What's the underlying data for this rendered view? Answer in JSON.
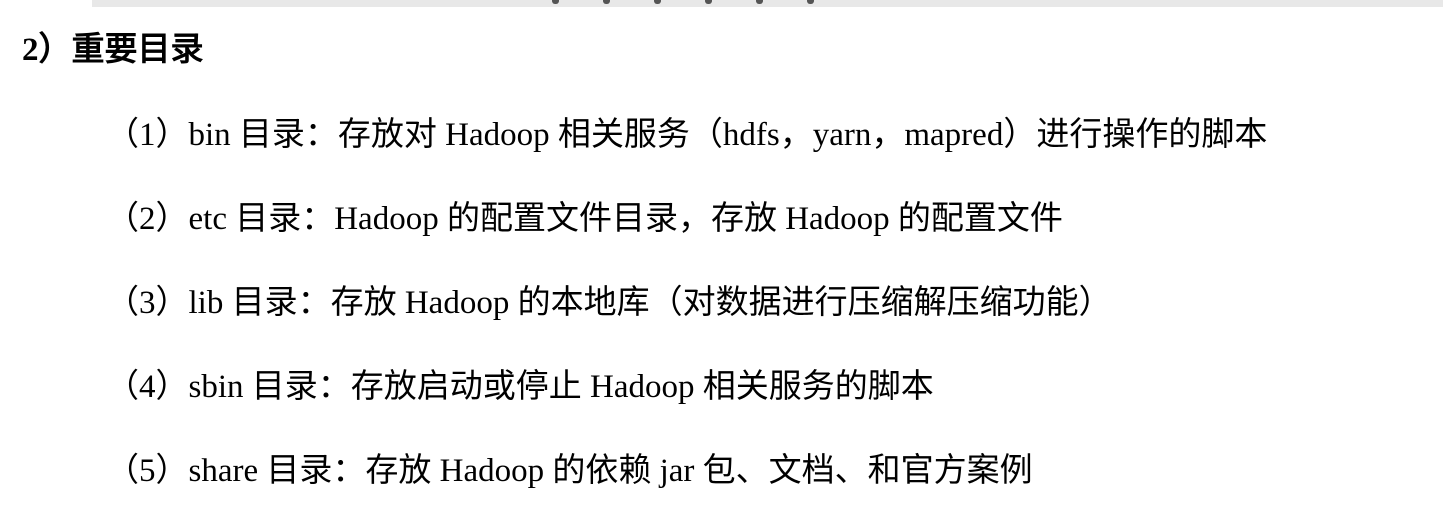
{
  "document": {
    "heading": "2）重要目录",
    "items": [
      {
        "text": "（1）bin 目录：存放对 Hadoop 相关服务（hdfs，yarn，mapred）进行操作的脚本"
      },
      {
        "text": "（2）etc 目录：Hadoop 的配置文件目录，存放 Hadoop 的配置文件"
      },
      {
        "text": "（3）lib 目录：存放 Hadoop 的本地库（对数据进行压缩解压缩功能）"
      },
      {
        "text": "（4）sbin 目录：存放启动或停止 Hadoop 相关服务的脚本"
      },
      {
        "text": "（5）share 目录：存放 Hadoop 的依赖 jar 包、文档、和官方案例"
      }
    ]
  }
}
